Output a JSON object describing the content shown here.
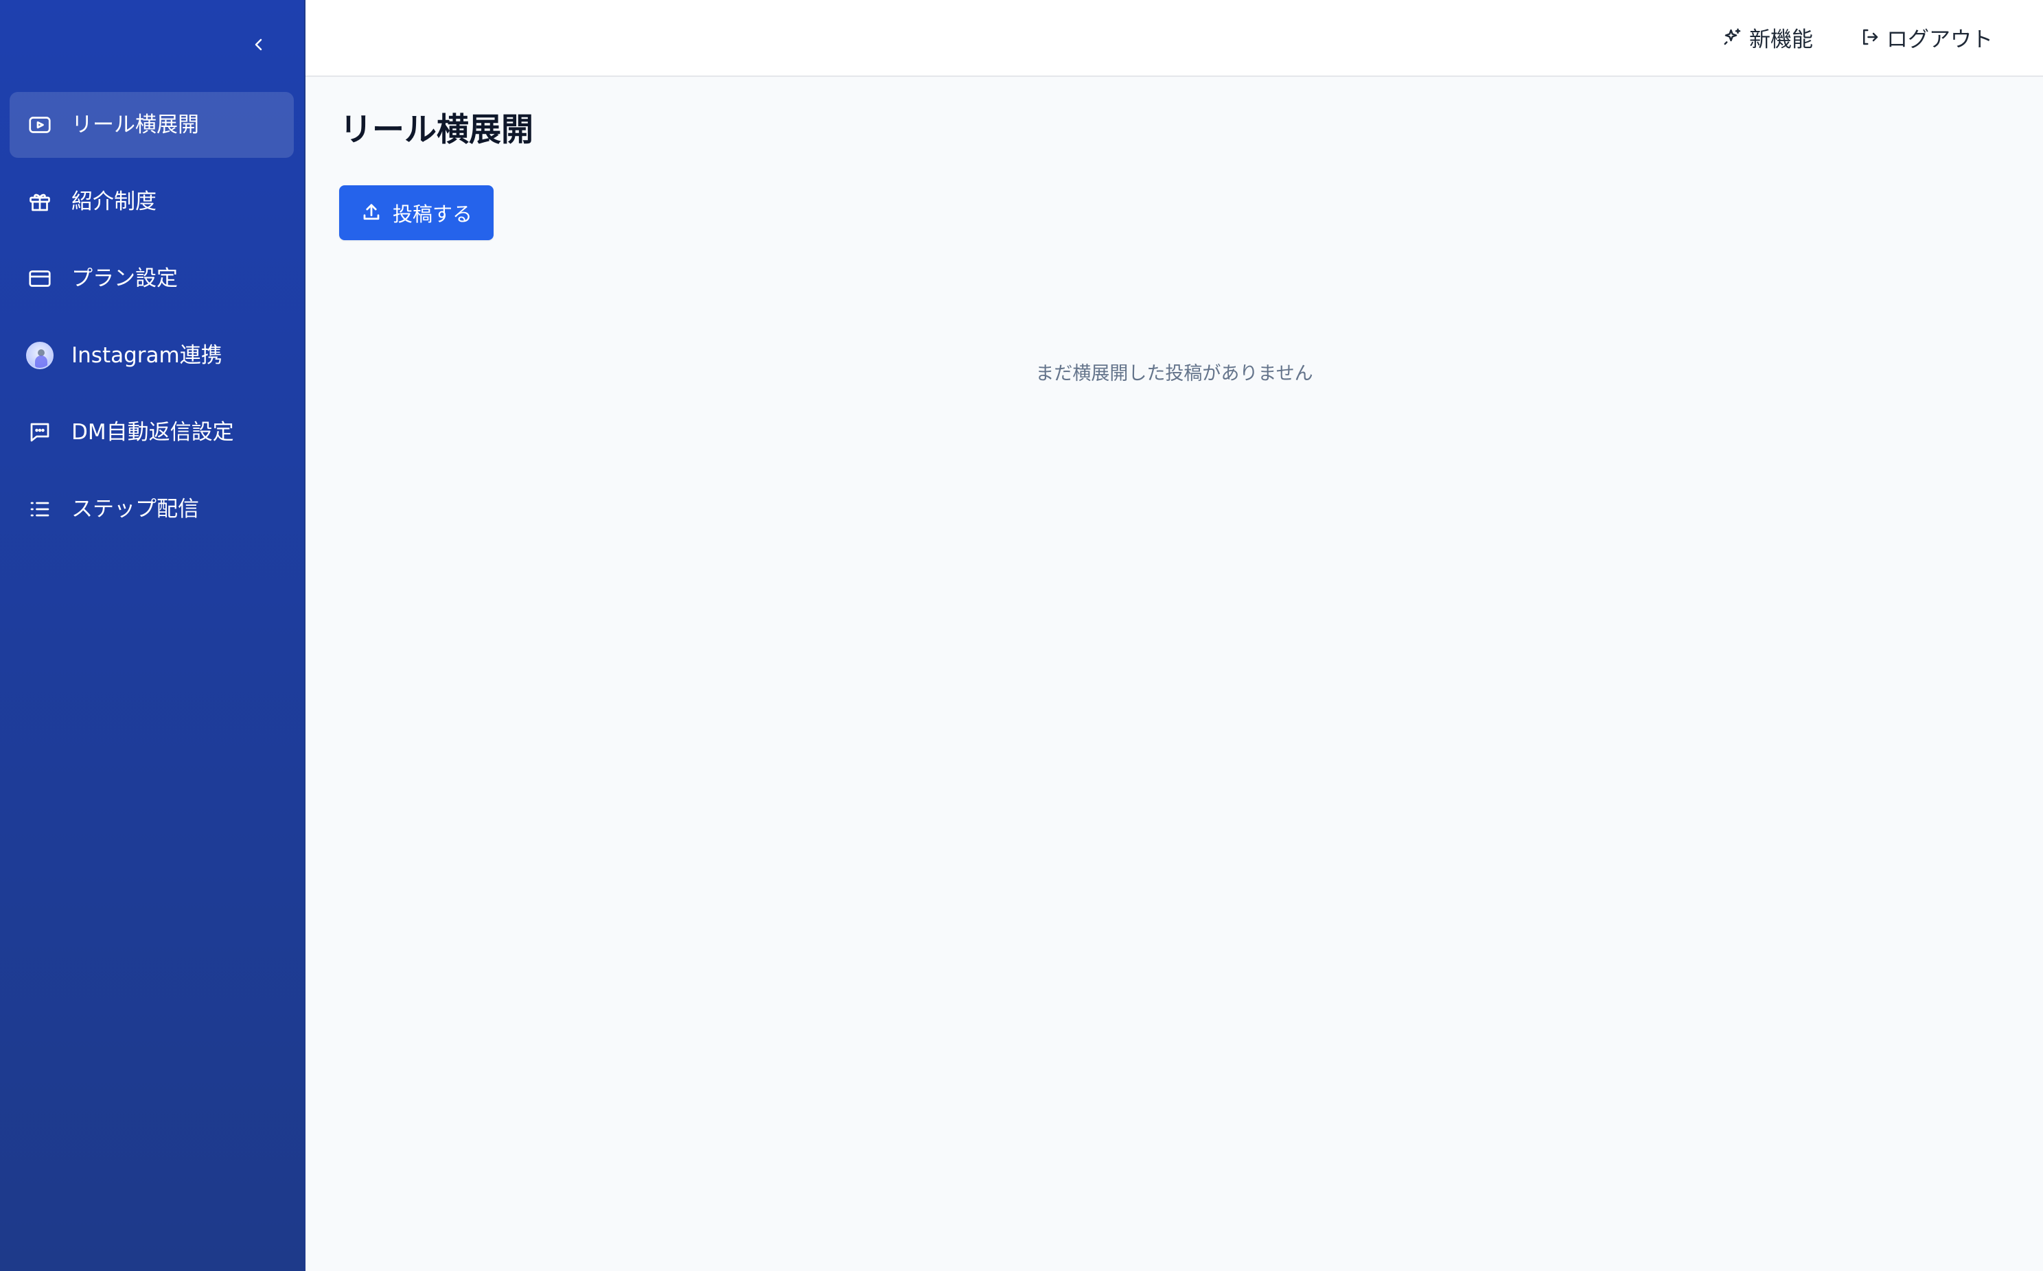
{
  "sidebar": {
    "collapse_icon": "chevron-left-icon",
    "items": [
      {
        "label": "リール横展開",
        "icon": "video-play-icon",
        "active": true
      },
      {
        "label": "紹介制度",
        "icon": "gift-icon",
        "active": false
      },
      {
        "label": "プラン設定",
        "icon": "credit-card-icon",
        "active": false
      },
      {
        "label": "Instagram連携",
        "icon": "instagram-avatar",
        "active": false
      },
      {
        "label": "DM自動返信設定",
        "icon": "message-icon",
        "active": false
      },
      {
        "label": "ステップ配信",
        "icon": "list-icon",
        "active": false
      }
    ]
  },
  "header": {
    "whats_new_label": "新機能",
    "logout_label": "ログアウト"
  },
  "main": {
    "title": "リール横展開",
    "post_button_label": "投稿する",
    "empty_message": "まだ横展開した投稿がありません"
  },
  "colors": {
    "sidebar_top": "#1e40af",
    "sidebar_bottom": "#1e3a8a",
    "primary": "#2563eb",
    "background": "#f8fafc"
  }
}
